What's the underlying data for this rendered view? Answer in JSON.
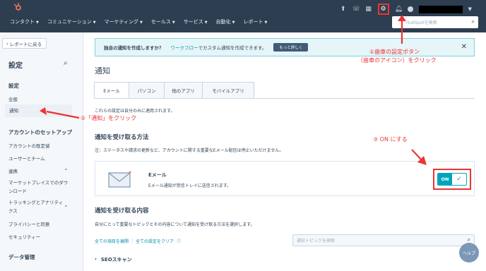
{
  "topnav": {
    "items": [
      "コンタクト",
      "コミュニケーション",
      "マーケティング",
      "セールス",
      "サービス",
      "自動化",
      "レポート"
    ],
    "search_placeholder": "HubSpotを検索"
  },
  "sidebar": {
    "back_label": "レポートに戻る",
    "title": "設定",
    "section_settings": "設定",
    "item_general": "全般",
    "item_notifications": "通知",
    "section_account": "アカウントのセットアップ",
    "item_defaults": "アカウントの既定値",
    "item_users": "ユーザーとチーム",
    "item_integrations": "連携",
    "item_marketplace": "マーケットプレイスでのダウンロード",
    "item_tracking": "トラッキングとアナリティクス",
    "item_privacy": "プライバシーと同意",
    "item_security": "セキュリティー",
    "section_data": "データ管理"
  },
  "banner": {
    "text": "独自の通知を作成しますか？",
    "link": "ワークフロー",
    "rest": "でカスタム通知を作成できます。",
    "button": "もっと詳しく"
  },
  "main": {
    "page_title": "通知",
    "tabs": [
      "Eメール",
      "パソコン",
      "他のアプリ",
      "モバイルアプリ"
    ],
    "desc": "これらの設定は自分のみに適用されます。",
    "section1": "通知を受け取る方法",
    "note1": "注：ステータスや請求の更新など、アカウントに関する重要なEメール配信は停止いただけません。",
    "email_title": "Eメール",
    "email_sub": "Eメール通知が受信トレイに送信されます。",
    "toggle_label": "ON",
    "section2": "通知を受け取る内容",
    "note2": "自分にとって重要なトピックとその内容について通知を受け取る方法を選択します。",
    "link_expand": "全ての項目を展開",
    "link_clear": "全ての設定をクリア",
    "topic_placeholder": "通知トピックを検索",
    "seo_label": "SEOスキャン",
    "help_label": "ヘルプ"
  },
  "annotations": {
    "a1_line1": "①歯車の設定ボタン",
    "a1_line2": "（歯車のアイコン）をクリック",
    "a2": "②「通知」をクリック",
    "a3": "③ ON にする"
  }
}
